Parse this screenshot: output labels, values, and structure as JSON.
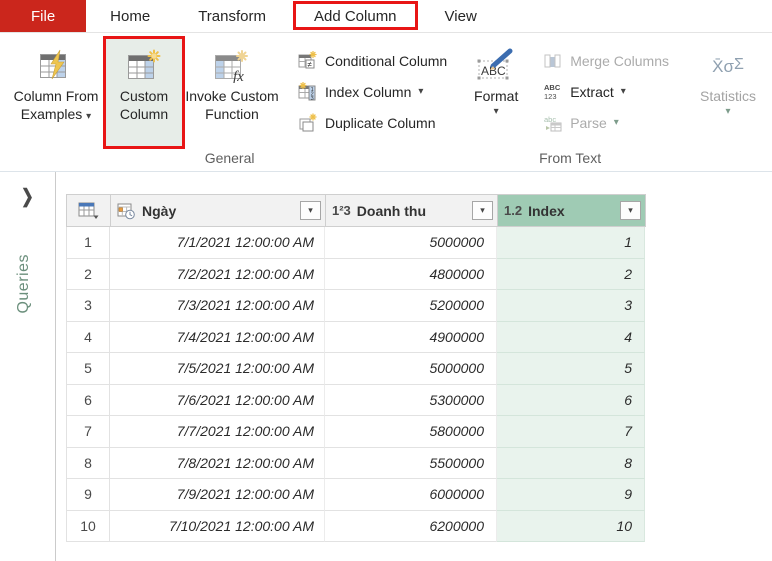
{
  "tab_bar": {
    "file": "File",
    "tabs": [
      {
        "label": "Home"
      },
      {
        "label": "Transform"
      },
      {
        "label": "Add Column",
        "annotated": true
      },
      {
        "label": "View"
      }
    ]
  },
  "ribbon": {
    "general": {
      "label": "General",
      "column_from_examples": "Column From Examples",
      "custom_column": "Custom Column",
      "invoke_custom_function": "Invoke Custom Function",
      "conditional_column": "Conditional Column",
      "index_column": "Index Column",
      "duplicate_column": "Duplicate Column"
    },
    "from_text": {
      "label": "From Text",
      "format": "Format",
      "merge_columns": "Merge Columns",
      "extract": "Extract",
      "parse": "Parse"
    },
    "statistics": {
      "label": "Statistics",
      "icon_top": "X̄σ",
      "icon_bottom": "Σ"
    }
  },
  "sidebar": {
    "queries_label": "Queries"
  },
  "icons": {
    "caret_down": "▾",
    "chevron_right": "❯"
  },
  "table": {
    "columns": [
      {
        "name": "Ngày",
        "type": "datetime"
      },
      {
        "name": "Doanh thu",
        "type": "whole-number",
        "type_label": "1²3"
      },
      {
        "name": "Index",
        "type": "decimal",
        "type_label": "1.2",
        "selected": true
      }
    ],
    "rows": [
      {
        "num": "1",
        "date": "7/1/2021 12:00:00 AM",
        "revenue": "5000000",
        "index": "1"
      },
      {
        "num": "2",
        "date": "7/2/2021 12:00:00 AM",
        "revenue": "4800000",
        "index": "2"
      },
      {
        "num": "3",
        "date": "7/3/2021 12:00:00 AM",
        "revenue": "5200000",
        "index": "3"
      },
      {
        "num": "4",
        "date": "7/4/2021 12:00:00 AM",
        "revenue": "4900000",
        "index": "4"
      },
      {
        "num": "5",
        "date": "7/5/2021 12:00:00 AM",
        "revenue": "5000000",
        "index": "5"
      },
      {
        "num": "6",
        "date": "7/6/2021 12:00:00 AM",
        "revenue": "5300000",
        "index": "6"
      },
      {
        "num": "7",
        "date": "7/7/2021 12:00:00 AM",
        "revenue": "5800000",
        "index": "7"
      },
      {
        "num": "8",
        "date": "7/8/2021 12:00:00 AM",
        "revenue": "5500000",
        "index": "8"
      },
      {
        "num": "9",
        "date": "7/9/2021 12:00:00 AM",
        "revenue": "6000000",
        "index": "9"
      },
      {
        "num": "10",
        "date": "7/10/2021 12:00:00 AM",
        "revenue": "6200000",
        "index": "10"
      }
    ]
  },
  "colors": {
    "file_tab_red": "#cb261c",
    "annotation_red": "#e81515",
    "selected_header_green": "#9fcbb4",
    "selected_cell_green": "#e9f3ed",
    "queries_label_green": "#6b8f7c"
  }
}
